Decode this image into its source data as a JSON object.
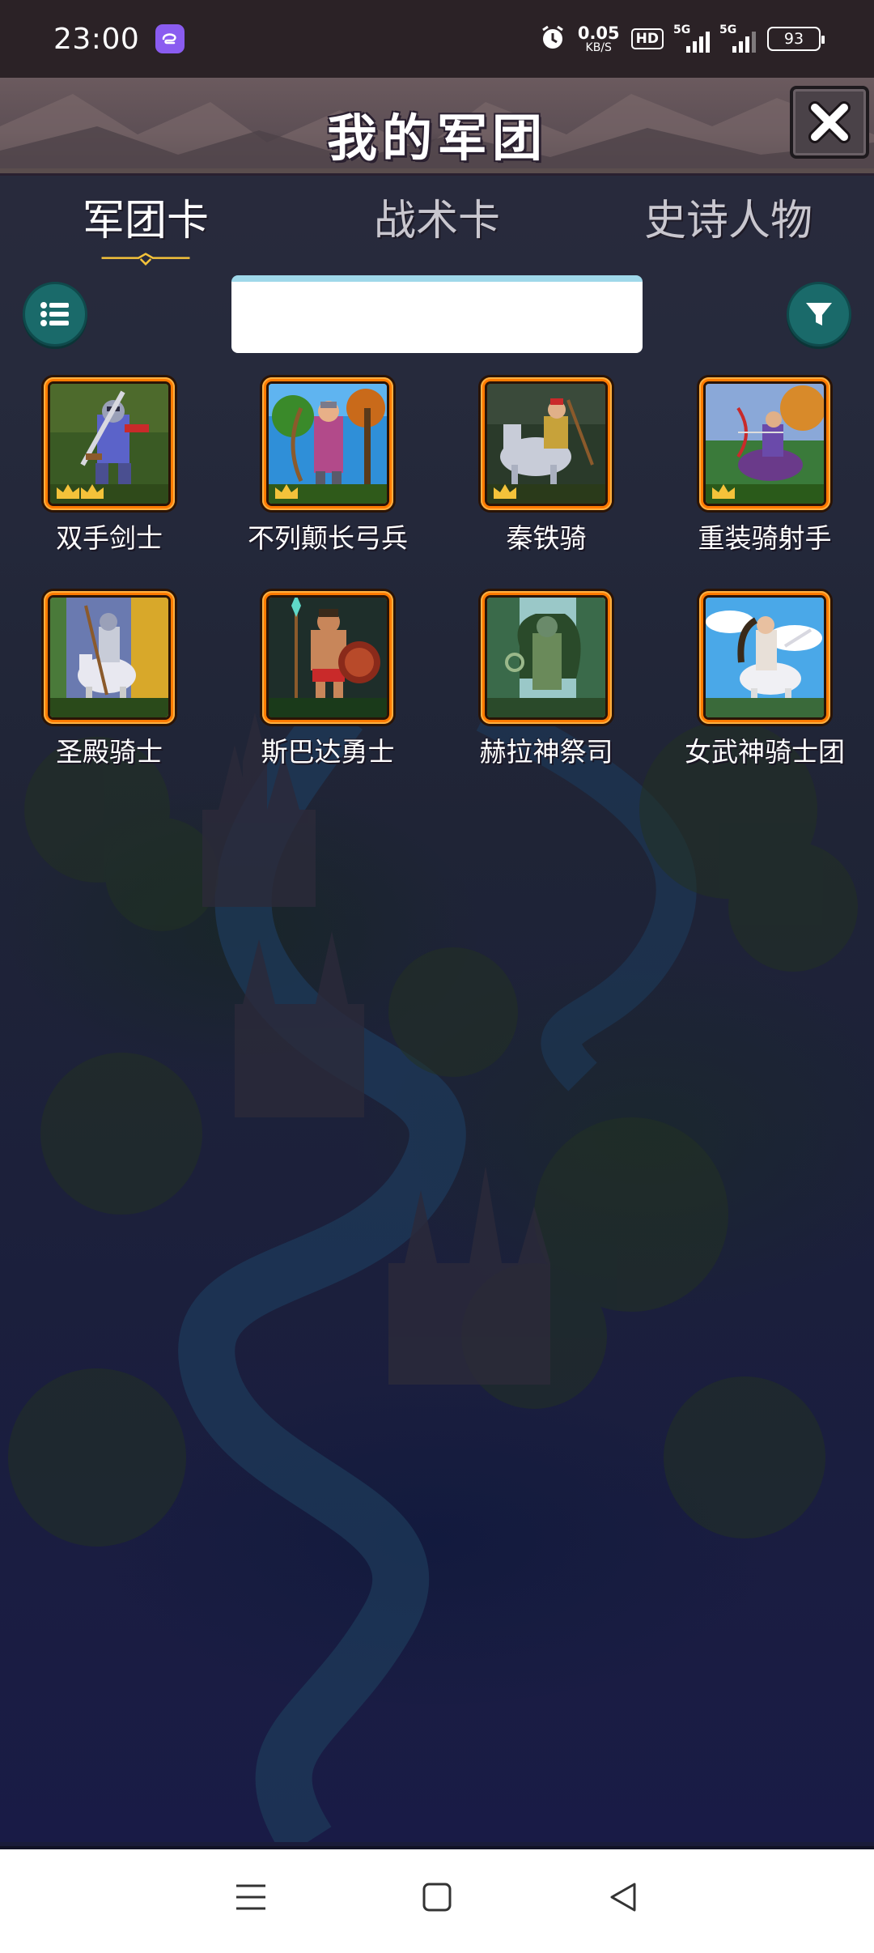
{
  "status_bar": {
    "time": "23:00",
    "net_speed_value": "0.05",
    "net_speed_unit": "KB/S",
    "hd_label": "HD",
    "sim1_label": "5G",
    "sim2_label": "5G",
    "battery": "93",
    "icons": [
      "app-badge-icon",
      "alarm-icon",
      "signal-icon",
      "battery-icon"
    ]
  },
  "header": {
    "title": "我的军团",
    "close_icon": "close-icon"
  },
  "tabs": [
    {
      "label": "军团卡",
      "active": true
    },
    {
      "label": "战术卡",
      "active": false
    },
    {
      "label": "史诗人物",
      "active": false
    }
  ],
  "toolbar": {
    "list_icon": "list-icon",
    "filter_icon": "filter-icon",
    "search_value": "",
    "search_placeholder": ""
  },
  "cards": [
    {
      "name": "双手剑士",
      "crowns": 2
    },
    {
      "name": "不列颠长弓兵",
      "crowns": 1
    },
    {
      "name": "秦铁骑",
      "crowns": 1
    },
    {
      "name": "重装骑射手",
      "crowns": 1
    },
    {
      "name": "圣殿骑士",
      "crowns": 0
    },
    {
      "name": "斯巴达勇士",
      "crowns": 0
    },
    {
      "name": "赫拉神祭司",
      "crowns": 0
    },
    {
      "name": "女武神骑士团",
      "crowns": 0
    }
  ],
  "nav_bar": {
    "icons": [
      "menu-icon",
      "home-icon",
      "back-icon"
    ]
  }
}
